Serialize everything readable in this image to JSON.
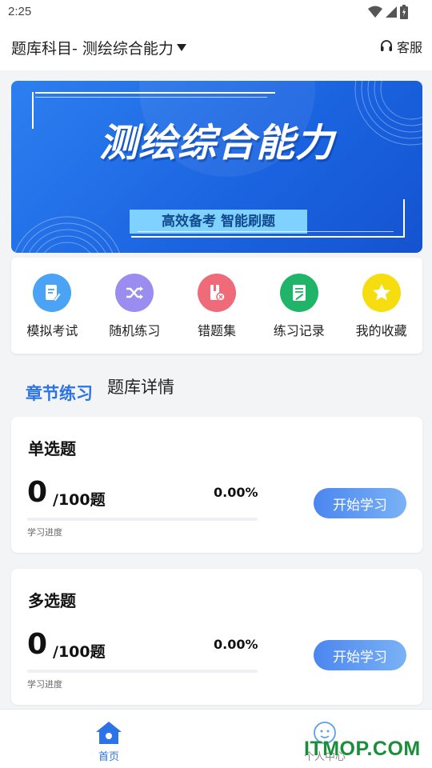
{
  "status_bar": {
    "time": "2:25"
  },
  "header": {
    "subject": "题库科目- 测绘综合能力",
    "support_label": "客服"
  },
  "banner": {
    "title": "测绘综合能力",
    "subtitle": "高效备考  智能刷题"
  },
  "quick_actions": [
    {
      "label": "模拟考试",
      "icon": "exam-doc-icon",
      "color": "#4aa3f5"
    },
    {
      "label": "随机练习",
      "icon": "shuffle-icon",
      "color": "#9b8cf0"
    },
    {
      "label": "错题集",
      "icon": "wrong-book-icon",
      "color": "#f06b7a"
    },
    {
      "label": "练习记录",
      "icon": "record-doc-icon",
      "color": "#1fb468"
    },
    {
      "label": "我的收藏",
      "icon": "star-icon",
      "color": "#f5dd10"
    }
  ],
  "tabs": {
    "active": "章节练习",
    "inactive": "题库详情"
  },
  "question_cards": [
    {
      "title": "单选题",
      "count": "0",
      "total": "/100题",
      "percent": "0.00%",
      "progress": 0,
      "progress_label": "学习进度",
      "button": "开始学习"
    },
    {
      "title": "多选题",
      "count": "0",
      "total": "/100题",
      "percent": "0.00%",
      "progress": 0,
      "progress_label": "学习进度",
      "button": "开始学习"
    }
  ],
  "bottom_nav": {
    "home": "首页",
    "me": "个人中心"
  },
  "watermark": "ITMOP.COM",
  "colors": {
    "accent": "#2c73e6",
    "banner": "#1a63e0"
  }
}
